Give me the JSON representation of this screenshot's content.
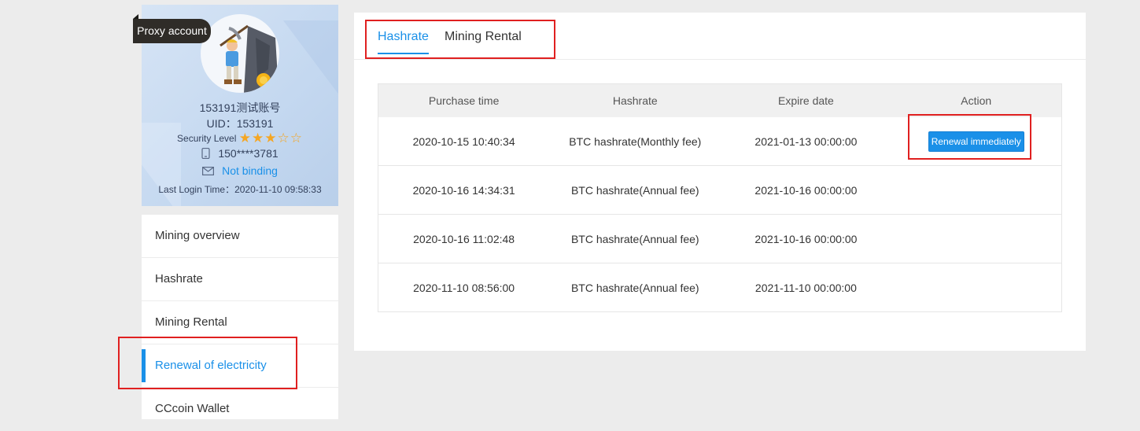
{
  "profile": {
    "proxy_tag": "Proxy account",
    "username": "153191测试账号",
    "uid": "UID：153191",
    "security_label": "Security Level",
    "security_stars": "★★★☆☆",
    "security_level": 3,
    "phone": "150****3781",
    "email_status": "Not binding",
    "last_login": "Last Login Time：2020-11-10 09:58:33"
  },
  "sidebar": {
    "items": [
      {
        "label": "Mining overview"
      },
      {
        "label": "Hashrate"
      },
      {
        "label": "Mining Rental"
      },
      {
        "label": "Renewal of electricity",
        "active": true
      },
      {
        "label": "CCcoin Wallet"
      }
    ]
  },
  "tabs": [
    {
      "label": "Hashrate",
      "active": true
    },
    {
      "label": "Mining Rental"
    }
  ],
  "table": {
    "headers": [
      "Purchase time",
      "Hashrate",
      "Expire date",
      "Action"
    ],
    "rows": [
      {
        "purchase": "2020-10-15 10:40:34",
        "hashrate": "BTC hashrate(Monthly fee)",
        "expire": "2021-01-13 00:00:00",
        "action": "Renewal immediately"
      },
      {
        "purchase": "2020-10-16 14:34:31",
        "hashrate": "BTC hashrate(Annual fee)",
        "expire": "2021-10-16 00:00:00",
        "action": ""
      },
      {
        "purchase": "2020-10-16 11:02:48",
        "hashrate": "BTC hashrate(Annual fee)",
        "expire": "2021-10-16 00:00:00",
        "action": ""
      },
      {
        "purchase": "2020-11-10 08:56:00",
        "hashrate": "BTC hashrate(Annual fee)",
        "expire": "2021-11-10 00:00:00",
        "action": ""
      }
    ]
  },
  "colors": {
    "accent": "#1a90e8",
    "highlight": "#e02020",
    "star": "#f5a623"
  },
  "icons": [
    "miner-avatar",
    "phone-icon",
    "mail-icon"
  ]
}
